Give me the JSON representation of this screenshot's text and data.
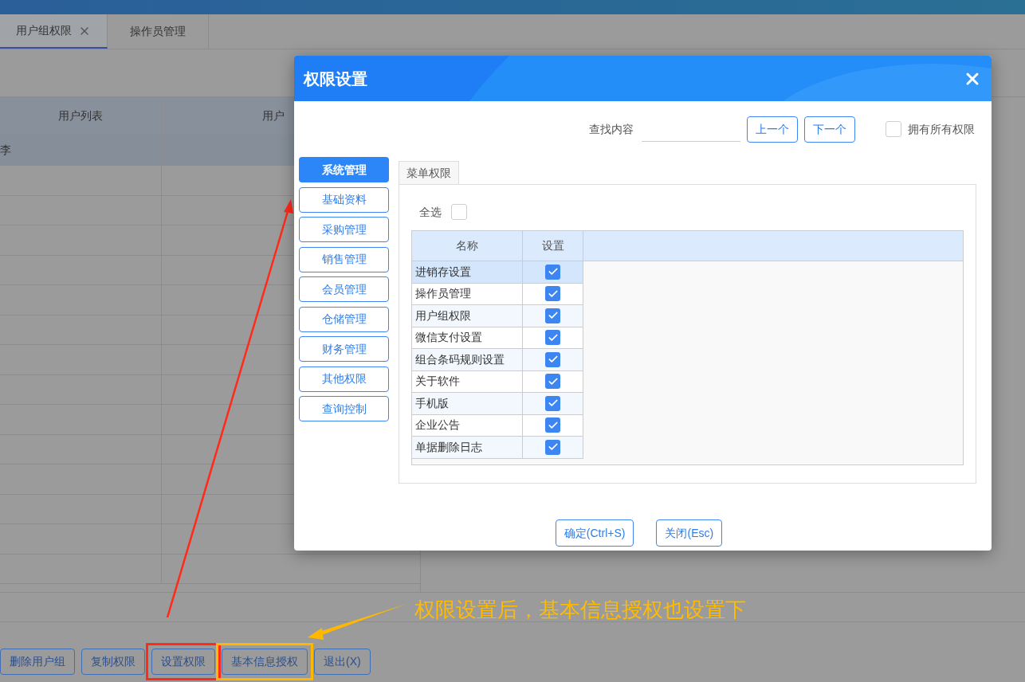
{
  "tabs": [
    {
      "label": "用户组权限",
      "selected": true,
      "closable": true
    },
    {
      "label": "操作员管理",
      "selected": false,
      "closable": false
    }
  ],
  "table": {
    "columns": [
      "用户列表",
      "用户"
    ],
    "rows": [
      {
        "name": "李",
        "selected": true
      }
    ]
  },
  "buttons": [
    {
      "label": "删除用户组"
    },
    {
      "label": "复制权限"
    },
    {
      "label": "设置权限",
      "color": "#ff2a1a"
    },
    {
      "label": "基本信息授权",
      "color": "#ffb800"
    },
    {
      "label": "退出(X)"
    }
  ],
  "annotation": {
    "text": "权限设置后，基本信息授权也设置下"
  },
  "dialog": {
    "title": "权限设置",
    "search": {
      "label": "查找内容"
    },
    "prev_button": "上一个",
    "next_button": "下一个",
    "all_permissions": {
      "label": "拥有所有权限",
      "checked": false
    },
    "categories": [
      {
        "label": "系统管理",
        "selected": true
      },
      {
        "label": "基础资料",
        "selected": false
      },
      {
        "label": "采购管理",
        "selected": false
      },
      {
        "label": "销售管理",
        "selected": false
      },
      {
        "label": "会员管理",
        "selected": false
      },
      {
        "label": "仓储管理",
        "selected": false
      },
      {
        "label": "财务管理",
        "selected": false
      },
      {
        "label": "其他权限",
        "selected": false
      },
      {
        "label": "查询控制",
        "selected": false
      }
    ],
    "panel_tabs": [
      {
        "label": "菜单权限",
        "selected": true
      }
    ],
    "select_all": {
      "label": "全选",
      "checked": false
    },
    "grid": {
      "columns": [
        "名称",
        "设置"
      ],
      "rows": [
        {
          "name": "进销存设置",
          "checked": true,
          "selected": true
        },
        {
          "name": "操作员管理",
          "checked": true,
          "selected": false
        },
        {
          "name": "用户组权限",
          "checked": true,
          "selected": false
        },
        {
          "name": "微信支付设置",
          "checked": true,
          "selected": false
        },
        {
          "name": "组合条码规则设置",
          "checked": true,
          "selected": false
        },
        {
          "name": "关于软件",
          "checked": true,
          "selected": false
        },
        {
          "name": "手机版",
          "checked": true,
          "selected": false
        },
        {
          "name": "企业公告",
          "checked": true,
          "selected": false
        },
        {
          "name": "单据删除日志",
          "checked": true,
          "selected": false
        }
      ]
    },
    "buttons": [
      "确定(Ctrl+S)",
      "关闭(Esc)"
    ]
  }
}
